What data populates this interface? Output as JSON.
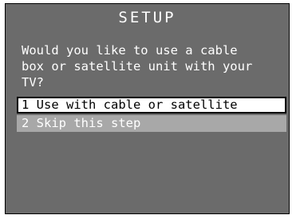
{
  "screen": {
    "title": "SETUP",
    "question": "Would you like to use a cable\nbox or satellite unit with your\nTV?",
    "options": [
      {
        "label": "1 Use with cable or satellite",
        "selected": true
      },
      {
        "label": "2 Skip this step",
        "selected": false
      }
    ]
  },
  "colors": {
    "background": "#6b6b6b",
    "selected_bg": "#ffffff",
    "unselected_bg": "#a8a8a8",
    "text": "#ffffff"
  }
}
